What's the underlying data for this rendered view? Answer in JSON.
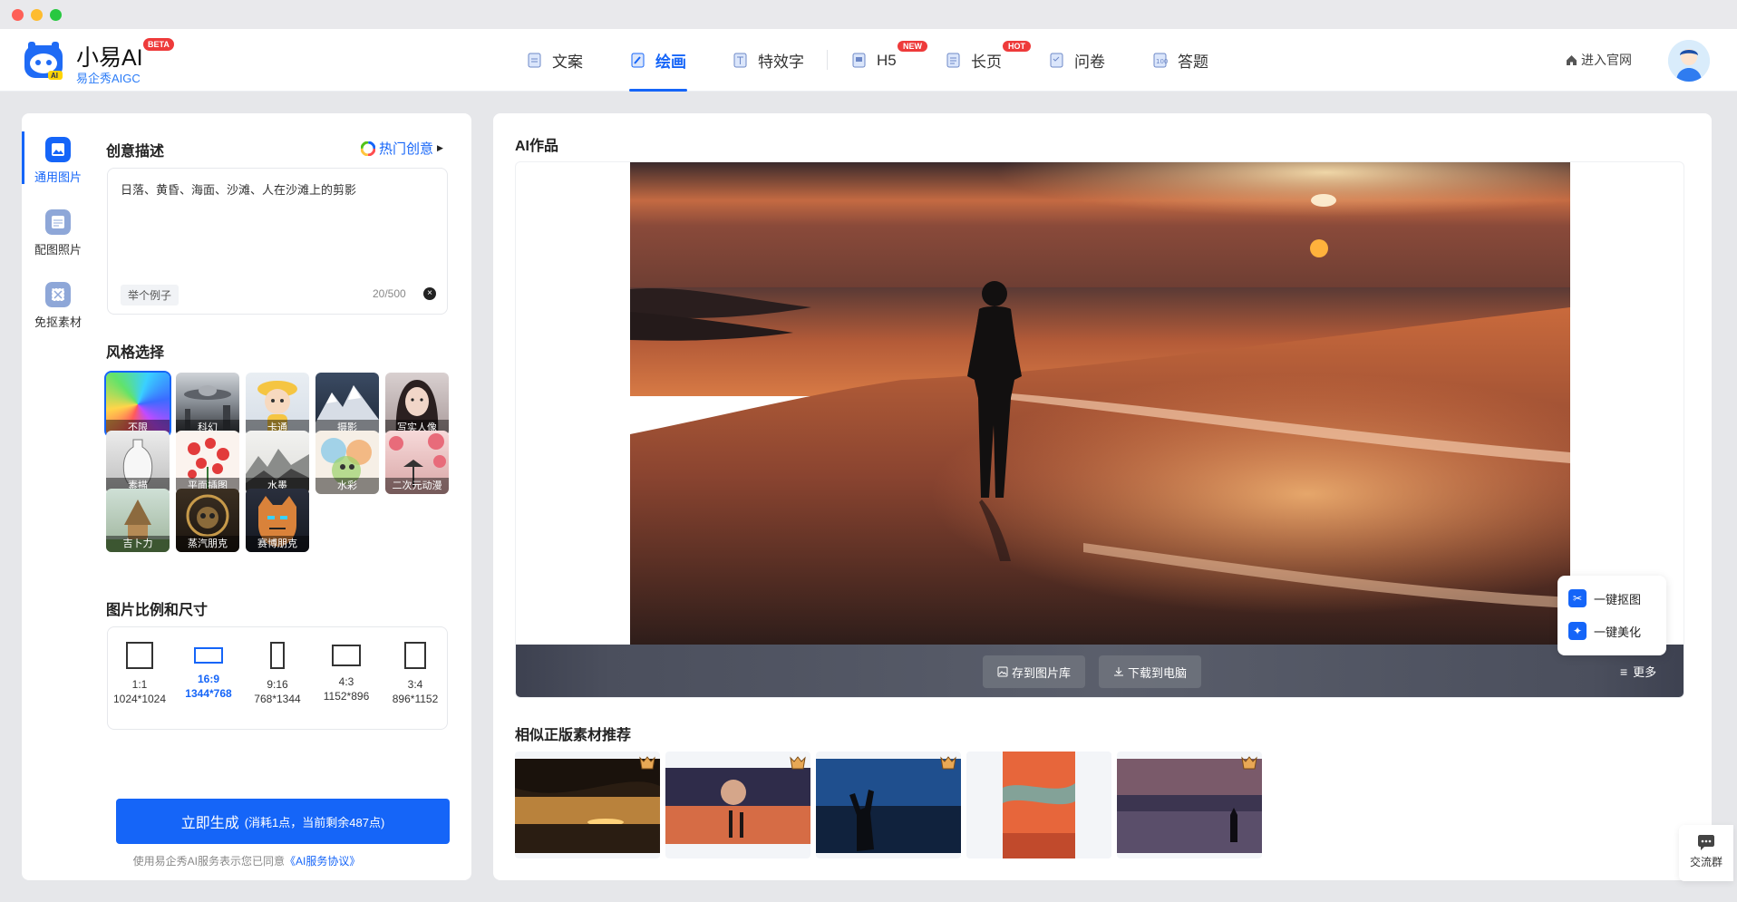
{
  "brand": {
    "name": "小易AI",
    "badge": "BETA",
    "subtitle": "易企秀AIGC"
  },
  "nav": {
    "items": [
      {
        "label": "文案",
        "active": false
      },
      {
        "label": "绘画",
        "active": true
      },
      {
        "label": "特效字",
        "active": false
      },
      {
        "label": "H5",
        "active": false,
        "tag": "NEW"
      },
      {
        "label": "长页",
        "active": false,
        "tag": "HOT"
      },
      {
        "label": "问卷",
        "active": false
      },
      {
        "label": "答题",
        "active": false
      }
    ],
    "official_link": "进入官网"
  },
  "sidebar": {
    "tabs": [
      {
        "label": "通用图片",
        "active": true
      },
      {
        "label": "配图照片",
        "active": false
      },
      {
        "label": "免抠素材",
        "active": false
      }
    ]
  },
  "prompt": {
    "section_title": "创意描述",
    "hot_ideas": "热门创意",
    "value": "日落、黄昏、海面、沙滩、人在沙滩上的剪影",
    "example_button": "举个例子",
    "counter": "20/500"
  },
  "styles": {
    "section_title": "风格选择",
    "items": [
      {
        "label": "不限",
        "selected": true
      },
      {
        "label": "科幻",
        "selected": false
      },
      {
        "label": "卡通",
        "selected": false
      },
      {
        "label": "摄影",
        "selected": false
      },
      {
        "label": "写实人像",
        "selected": false
      },
      {
        "label": "素描",
        "selected": false
      },
      {
        "label": "平面插图",
        "selected": false
      },
      {
        "label": "水墨",
        "selected": false
      },
      {
        "label": "水彩",
        "selected": false
      },
      {
        "label": "二次元动漫",
        "selected": false
      },
      {
        "label": "吉卜力",
        "selected": false
      },
      {
        "label": "蒸汽朋克",
        "selected": false
      },
      {
        "label": "赛博朋克",
        "selected": false
      }
    ]
  },
  "ratios": {
    "section_title": "图片比例和尺寸",
    "items": [
      {
        "ratio": "1:1",
        "size": "1024*1024",
        "active": false
      },
      {
        "ratio": "16:9",
        "size": "1344*768",
        "active": true
      },
      {
        "ratio": "9:16",
        "size": "768*1344",
        "active": false
      },
      {
        "ratio": "4:3",
        "size": "1152*896",
        "active": false
      },
      {
        "ratio": "3:4",
        "size": "896*1152",
        "active": false
      }
    ]
  },
  "generate": {
    "label": "立即生成",
    "detail": "(消耗1点，当前剩余487点)",
    "agreement_prefix": "使用易企秀AI服务表示您已同意",
    "agreement_link": "《AI服务协议》"
  },
  "artwork": {
    "section_title": "AI作品",
    "save_button": "存到图片库",
    "download_button": "下载到电脑",
    "more_button": "更多",
    "float_menu": {
      "cutout": "一键抠图",
      "beautify": "一键美化"
    }
  },
  "recommend": {
    "section_title": "相似正版素材推荐",
    "count": 5
  },
  "float_chat": {
    "label": "交流群"
  },
  "colors": {
    "accent": "#1565f8",
    "hot_tag": "#ee3a3a"
  }
}
